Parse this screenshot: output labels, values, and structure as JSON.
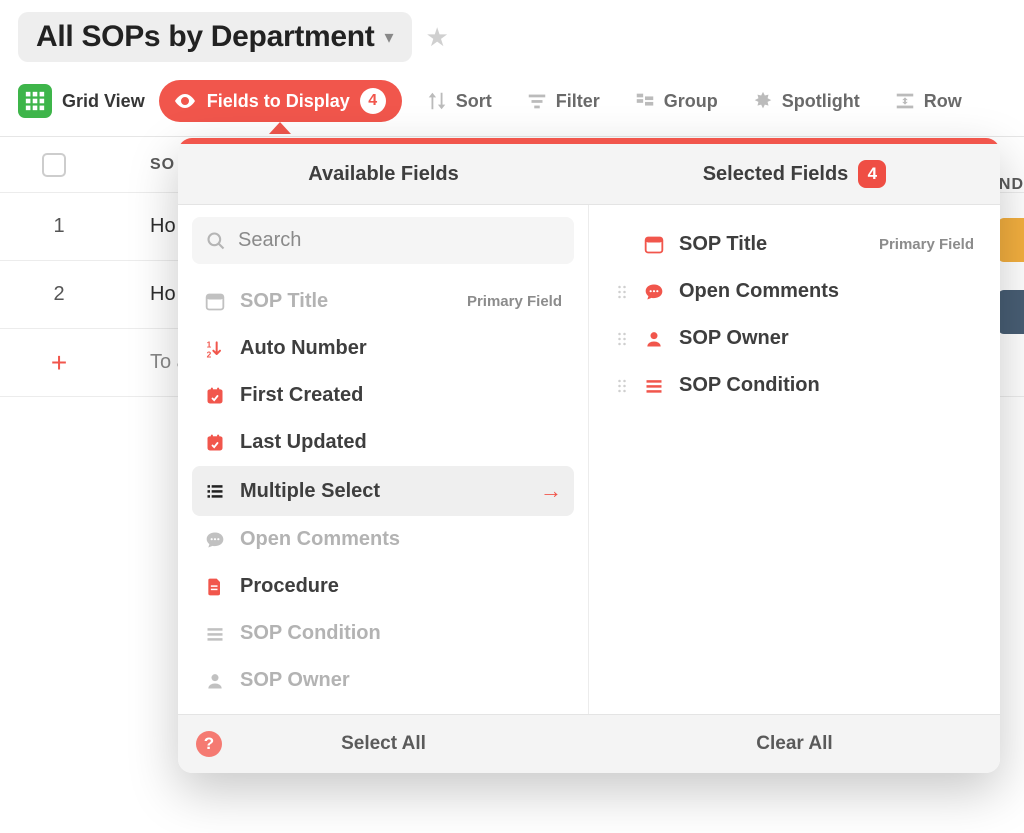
{
  "title": "All SOPs by Department",
  "toolbar": {
    "grid_view": "Grid View",
    "fields_to_display": "Fields to Display",
    "fields_count": "4",
    "sort": "Sort",
    "filter": "Filter",
    "group": "Group",
    "spotlight": "Spotlight",
    "row": "Row"
  },
  "grid": {
    "col_sop_abbrev": "SO",
    "col_right_abbrev": "ND",
    "rows": [
      {
        "index": "1",
        "label_prefix": "Ho"
      },
      {
        "index": "2",
        "label_prefix": "Ho"
      }
    ],
    "add_prefix": "To a"
  },
  "popover": {
    "available_title": "Available Fields",
    "selected_title": "Selected Fields",
    "selected_count": "4",
    "search_placeholder": "Search",
    "primary_tag": "Primary Field",
    "available": [
      {
        "icon": "window",
        "label": "SOP Title",
        "disabled": true,
        "primary": true
      },
      {
        "icon": "autonum",
        "label": "Auto Number",
        "disabled": false
      },
      {
        "icon": "calendar",
        "label": "First Created",
        "disabled": false
      },
      {
        "icon": "calendar",
        "label": "Last Updated",
        "disabled": false
      },
      {
        "icon": "list",
        "label": "Multiple Select",
        "disabled": false,
        "hover": true,
        "arrow": true
      },
      {
        "icon": "comment",
        "label": "Open Comments",
        "disabled": true
      },
      {
        "icon": "doc",
        "label": "Procedure",
        "disabled": false
      },
      {
        "icon": "lines",
        "label": "SOP Condition",
        "disabled": true
      },
      {
        "icon": "user",
        "label": "SOP Owner",
        "disabled": true
      }
    ],
    "selected": [
      {
        "icon": "window",
        "label": "SOP Title",
        "primary": true,
        "draggable": false
      },
      {
        "icon": "comment",
        "label": "Open Comments",
        "draggable": true
      },
      {
        "icon": "user",
        "label": "SOP Owner",
        "draggable": true
      },
      {
        "icon": "lines",
        "label": "SOP Condition",
        "draggable": true
      }
    ],
    "select_all": "Select All",
    "clear_all": "Clear All"
  }
}
